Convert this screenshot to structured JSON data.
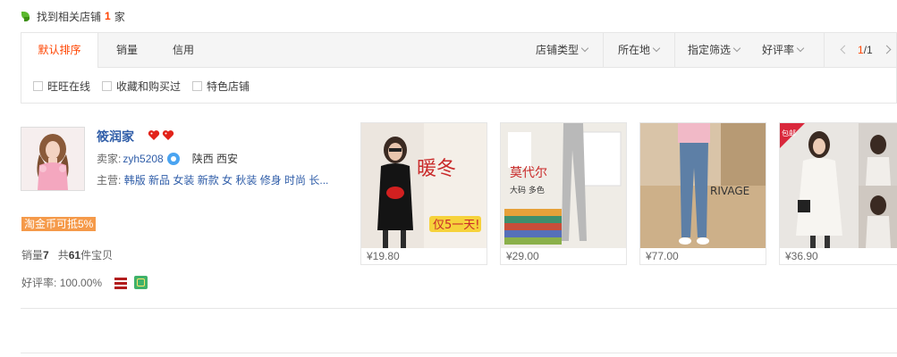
{
  "found": {
    "prefix": "找到相关店铺",
    "count": "1",
    "suffix": "家"
  },
  "sort_tabs": [
    {
      "label": "默认排序",
      "active": true
    },
    {
      "label": "销量",
      "active": false
    },
    {
      "label": "信用",
      "active": false
    }
  ],
  "filters": [
    {
      "label": "店铺类型"
    },
    {
      "label": "所在地"
    },
    {
      "label": "指定筛选"
    },
    {
      "label": "好评率"
    }
  ],
  "pager": {
    "current": "1",
    "separator": "/",
    "total": "1"
  },
  "checkboxes": [
    {
      "label": "旺旺在线"
    },
    {
      "label": "收藏和购买过"
    },
    {
      "label": "特色店铺"
    }
  ],
  "shop": {
    "name": "筱润家",
    "seller_label": "卖家:",
    "seller_name": "zyh5208",
    "location": "陕西 西安",
    "main_label": "主营:",
    "main_categories": "韩版 新品 女装 新款 女 秋装 修身 时尚 长...",
    "coupon": "淘金币可抵5%",
    "sales_label": "销量",
    "sales_value": "7",
    "items_prefix": "共",
    "items_value": "61",
    "items_suffix": "件宝贝",
    "rating_label": "好评率:",
    "rating_value": "100.00%"
  },
  "products": [
    {
      "price": "¥19.80",
      "image_text": "暖冬",
      "image_subtext": "仅5一天!"
    },
    {
      "price": "¥29.00",
      "image_text": "莫代尔",
      "image_subtext": "大码 多色"
    },
    {
      "price": "¥77.00",
      "image_text": "RIVAGE",
      "image_subtext": ""
    },
    {
      "price": "¥36.90",
      "image_text": "包邮",
      "image_subtext": ""
    }
  ],
  "colors": {
    "accent": "#ff4400",
    "link": "#2f5da8",
    "coupon": "#f59a4a"
  }
}
